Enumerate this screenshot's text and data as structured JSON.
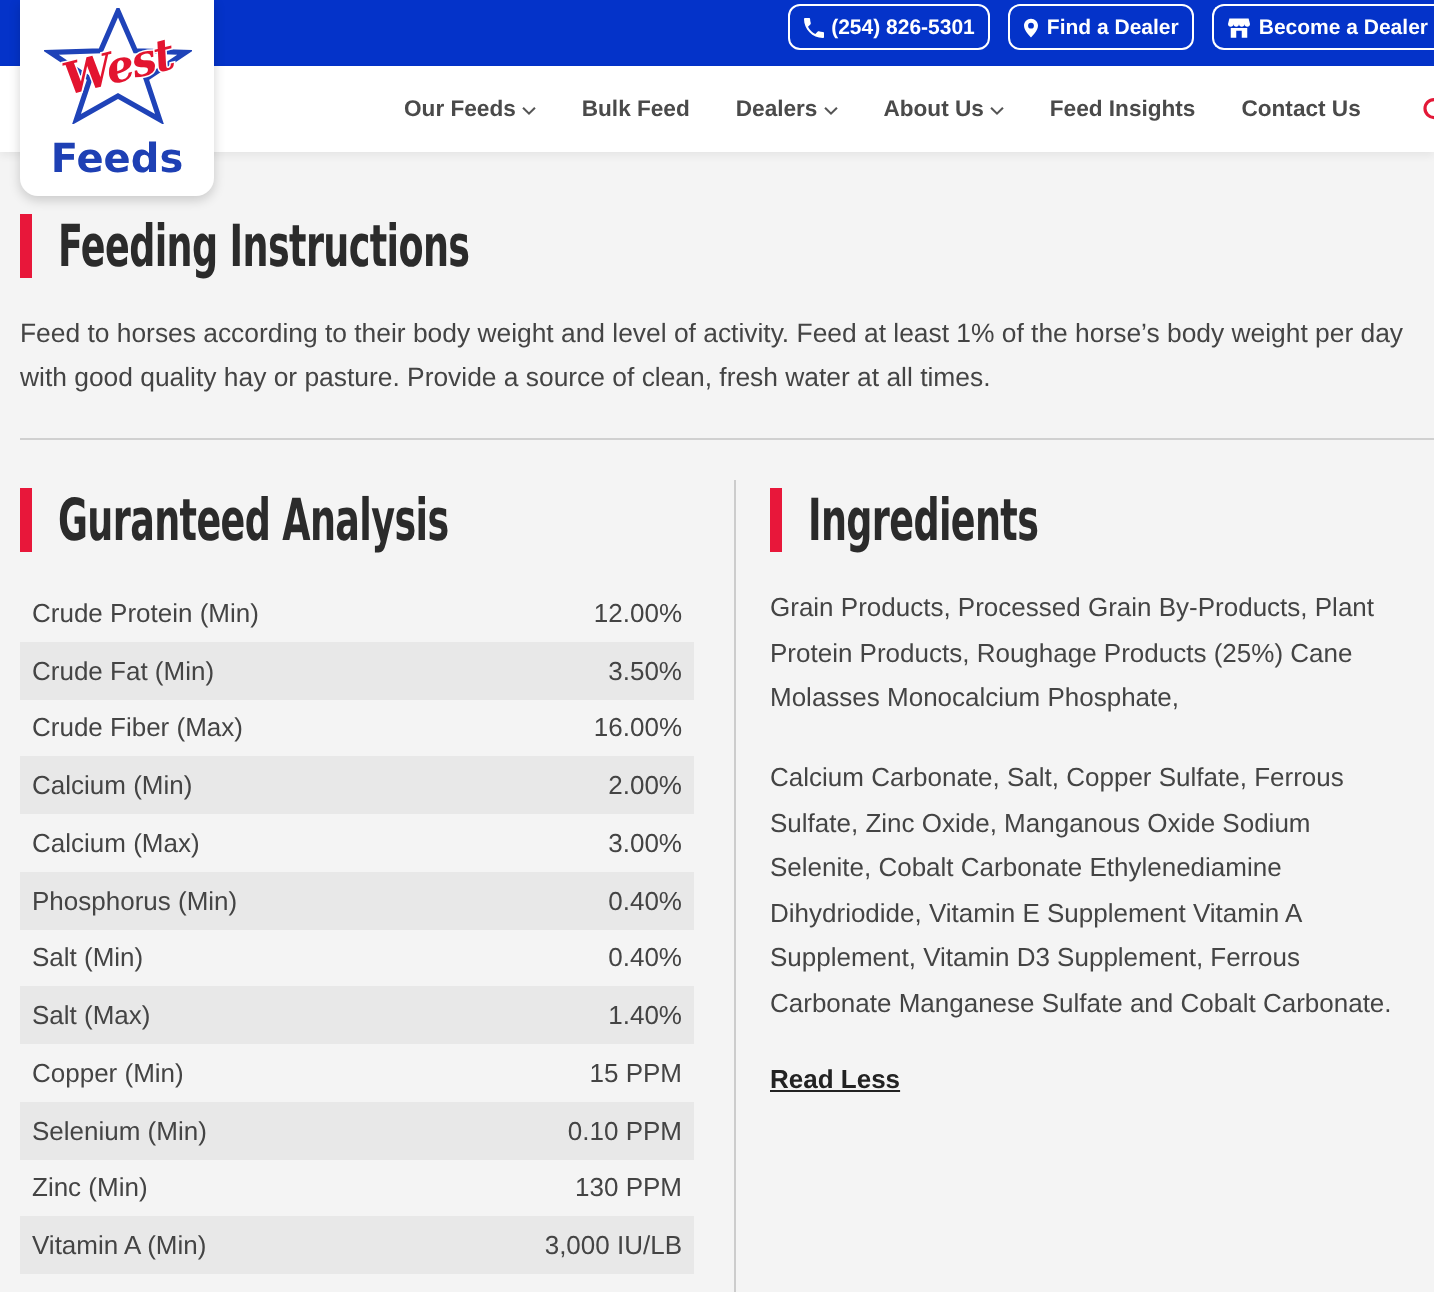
{
  "top_bar": {
    "buttons": [
      {
        "kind": "phone",
        "label": "(254) 826-5301"
      },
      {
        "kind": "location",
        "label": "Find a Dealer"
      },
      {
        "kind": "store",
        "label": "Become a Dealer"
      }
    ]
  },
  "logo": {
    "script": "West",
    "word": "Feeds"
  },
  "nav": {
    "items": [
      {
        "label": "Our Feeds",
        "dropdown": true
      },
      {
        "label": "Bulk Feed",
        "dropdown": false
      },
      {
        "label": "Dealers",
        "dropdown": true
      },
      {
        "label": "About Us",
        "dropdown": true
      },
      {
        "label": "Feed Insights",
        "dropdown": false
      },
      {
        "label": "Contact Us",
        "dropdown": false
      }
    ]
  },
  "feeding_instructions": {
    "title": "Feeding Instructions",
    "text": "Feed to horses according to their body weight and level of activity. Feed at least 1% of the horse’s body weight per day with good quality hay or pasture. Provide a source of clean, fresh water at all times."
  },
  "guaranteed_analysis": {
    "title": "Guranteed Analysis",
    "rows": [
      {
        "nutrient": "Crude Protein (Min)",
        "value": "12.00%"
      },
      {
        "nutrient": "Crude Fat (Min)",
        "value": "3.50%"
      },
      {
        "nutrient": "Crude Fiber (Max)",
        "value": "16.00%"
      },
      {
        "nutrient": "Calcium (Min)",
        "value": "2.00%"
      },
      {
        "nutrient": "Calcium (Max)",
        "value": "3.00%"
      },
      {
        "nutrient": "Phosphorus (Min)",
        "value": "0.40%"
      },
      {
        "nutrient": "Salt (Min)",
        "value": "0.40%"
      },
      {
        "nutrient": "Salt (Max)",
        "value": "1.40%"
      },
      {
        "nutrient": "Copper (Min)",
        "value": "15 PPM"
      },
      {
        "nutrient": "Selenium (Min)",
        "value": "0.10 PPM"
      },
      {
        "nutrient": "Zinc (Min)",
        "value": "130 PPM"
      },
      {
        "nutrient": "Vitamin A (Min)",
        "value": "3,000 IU/LB"
      }
    ]
  },
  "ingredients": {
    "title": "Ingredients",
    "paragraphs": [
      "Grain Products, Processed Grain By-Products, Plant Protein Products, Roughage Products (25%) Cane Molasses Monocalcium Phosphate,",
      "Calcium Carbonate, Salt, Copper Sulfate, Ferrous Sulfate, Zinc Oxide, Manganous Oxide Sodium Selenite, Cobalt Carbonate Ethylenediamine Dihydriodide, Vitamin E Supplement Vitamin A Supplement, Vitamin D3 Supplement, Ferrous Carbonate Manganese Sulfate and Cobalt Carbonate."
    ],
    "link": "Read Less"
  }
}
